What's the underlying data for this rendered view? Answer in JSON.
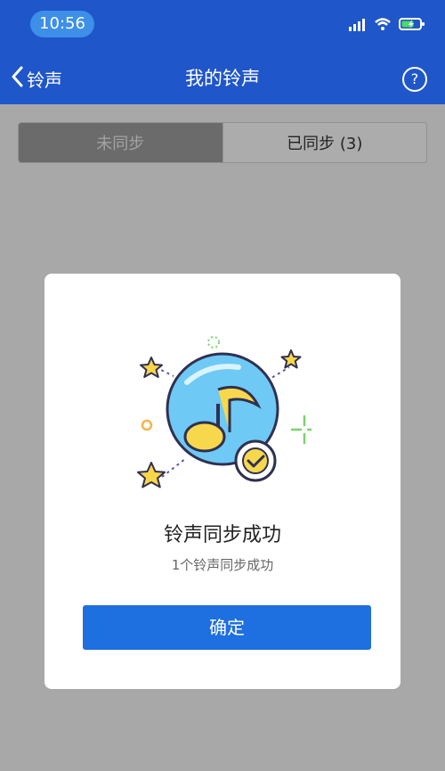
{
  "status_bar": {
    "time": "10:56"
  },
  "nav": {
    "back_label": "铃声",
    "title": "我的铃声",
    "help_label": "?"
  },
  "tabs": {
    "unsynced_label": "未同步",
    "synced_label": "已同步 (3)"
  },
  "dialog": {
    "title": "铃声同步成功",
    "subtitle": "1个铃声同步成功",
    "confirm_label": "确定"
  },
  "icons": [
    "back-chevron-icon",
    "help-icon",
    "signal-icon",
    "wifi-icon",
    "battery-charging-icon",
    "music-note-icon",
    "check-badge-icon",
    "star-icon",
    "sparkle-icon"
  ],
  "colors": {
    "header": "#1f56c9",
    "time_pill": "#3d8fe8",
    "primary_button": "#1e6fe0"
  }
}
